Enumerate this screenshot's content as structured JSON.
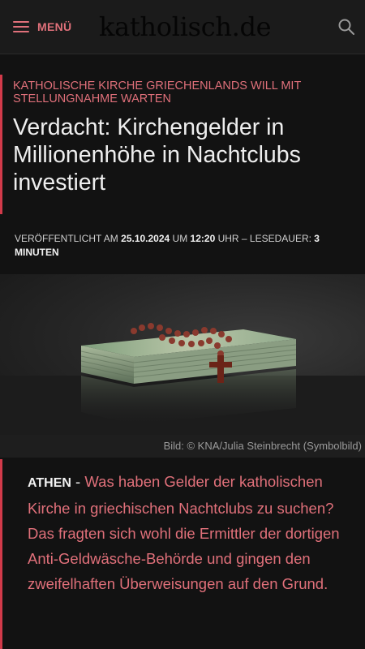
{
  "header": {
    "menu_label": "MENÜ",
    "logo_text": "katholisch.de",
    "search_icon": "search-icon"
  },
  "article": {
    "kicker": "KATHOLISCHE KIRCHE GRIECHENLANDS WILL MIT STELLUNGNAHME WARTEN",
    "headline": "Verdacht: Kirchengelder in Millionenhöhe in Nachtclubs investiert",
    "meta": {
      "published_prefix": "VERÖFFENTLICHT AM ",
      "date": "25.10.2024",
      "at": " UM ",
      "time": "12:20",
      "time_suffix": " UHR – LESEDAUER: ",
      "read_time": "3",
      "read_unit": "MINUTEN"
    },
    "image_caption": "Bild: © KNA/Julia Steinbrecht  (Symbolbild)",
    "dateline": "ATHEN",
    "separator": " - ",
    "lead": "Was haben Gelder der katholischen Kirche in griechischen Nachtclubs zu suchen? Das fragten sich wohl die Ermittler der dortigen Anti-Geldwäsche-Behörde und gingen den zweifelhaften Überweisungen auf den Grund."
  },
  "colors": {
    "accent": "#e0707a",
    "accent_bar": "#d23a4a",
    "background": "#121212"
  }
}
